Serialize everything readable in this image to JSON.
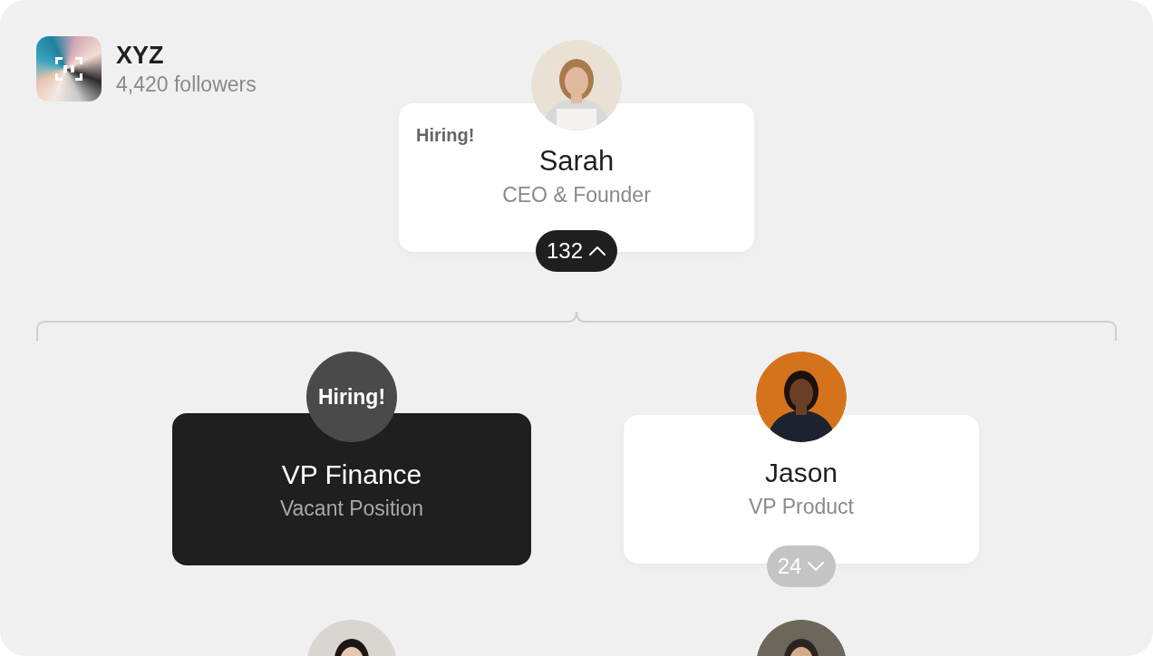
{
  "company": {
    "name": "XYZ",
    "followers": "4,420 followers"
  },
  "root": {
    "tag": "Hiring!",
    "name": "Sarah",
    "title": "CEO & Founder",
    "count": "132",
    "expanded": true
  },
  "children": [
    {
      "kind": "vacant",
      "badge": "Hiring!",
      "name": "VP Finance",
      "title": "Vacant Position"
    },
    {
      "kind": "person",
      "name": "Jason",
      "title": "VP Product",
      "count": "24",
      "expanded": false
    }
  ]
}
